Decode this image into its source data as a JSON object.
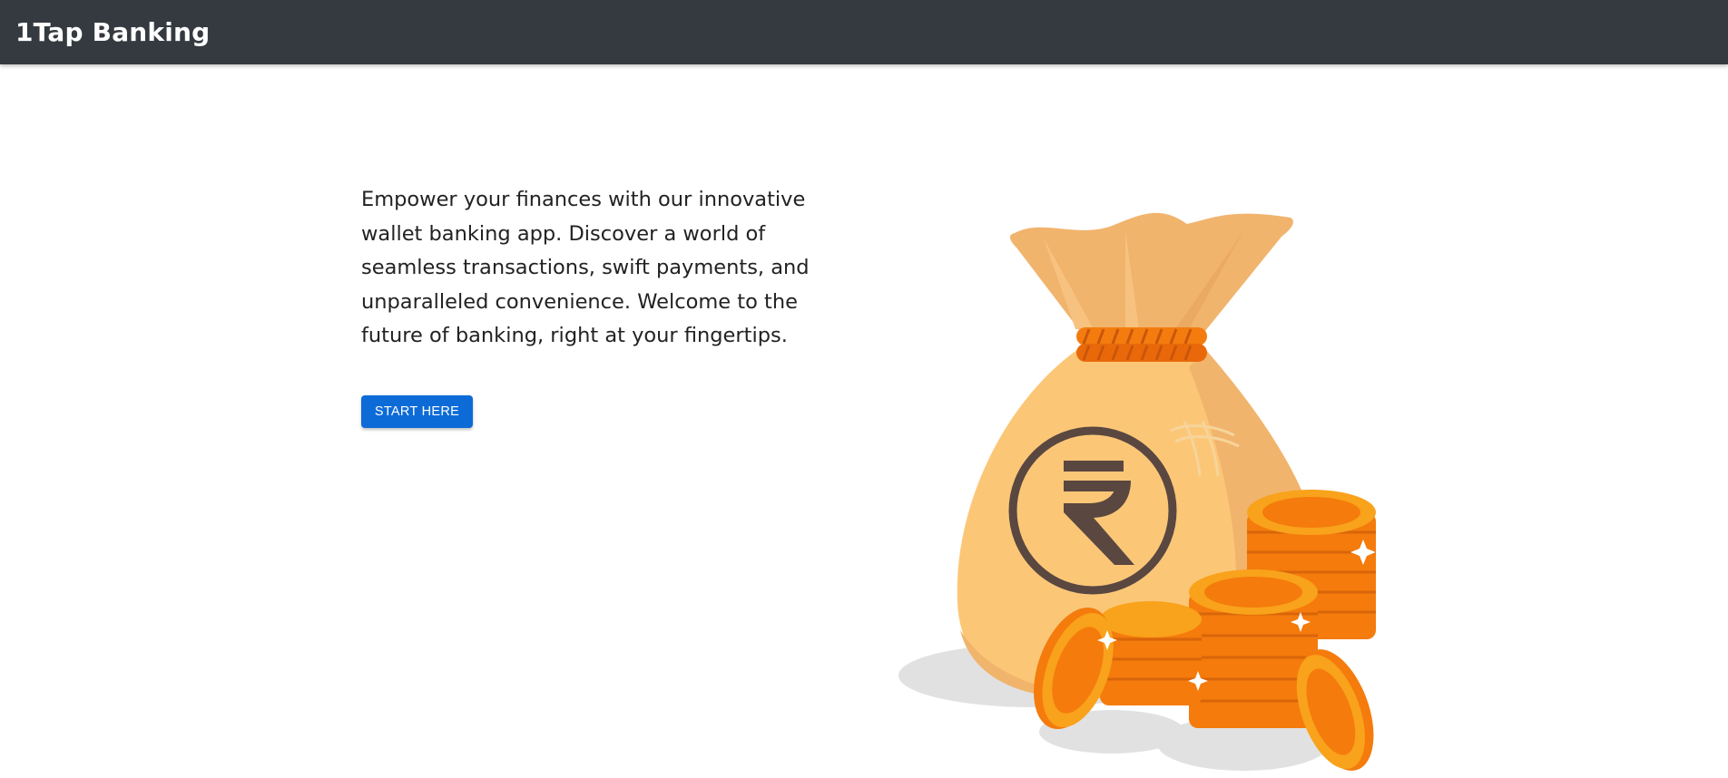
{
  "appbar": {
    "brand": "1Tap Banking"
  },
  "hero": {
    "text": "Empower your finances with our innovative wallet banking app. Discover a world of seamless transactions, swift payments, and unparalleled convenience. Welcome to the future of banking, right at your fingertips.",
    "button_label": "START HERE"
  },
  "illustration": {
    "icon": "money-bag-with-rupee-coins",
    "colors": {
      "bag": "#fbc777",
      "bag_shade": "#f1b46d",
      "rope": "#f47c0f",
      "symbol": "#5a4740",
      "coin": "#f9a21b",
      "coin_dark": "#f47b0c",
      "shadow": "#e1e1e1"
    }
  },
  "colors": {
    "appbar_bg": "#343a40",
    "button_bg": "#0d6bd8"
  }
}
